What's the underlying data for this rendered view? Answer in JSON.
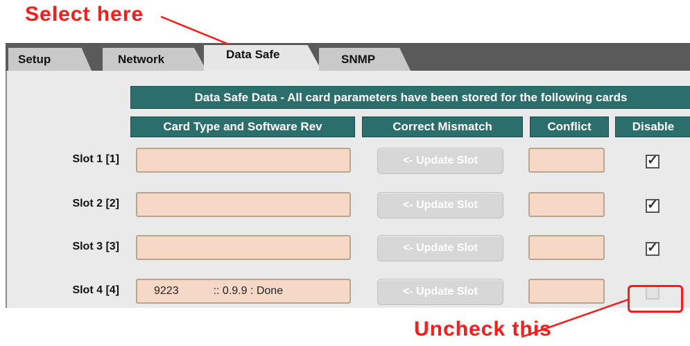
{
  "annotations": {
    "select_here": "Select here",
    "uncheck_this": "Uncheck this",
    "color": "#ff1a1a"
  },
  "tabs": [
    {
      "label": "Setup",
      "active": false
    },
    {
      "label": "Network",
      "active": false
    },
    {
      "label": "Data Safe",
      "active": true
    },
    {
      "label": "SNMP",
      "active": false
    }
  ],
  "headers": {
    "main": "Data Safe Data - All card parameters have been stored for the following cards",
    "card_type": "Card Type and Software Rev",
    "correct_mismatch": "Correct Mismatch",
    "conflict": "Conflict",
    "disable": "Disable"
  },
  "slots": [
    {
      "label": "Slot 1 [1]",
      "card_type": "",
      "version": "",
      "button": "<- Update Slot",
      "conflict": "",
      "disable": true
    },
    {
      "label": "Slot 2 [2]",
      "card_type": "",
      "version": "",
      "button": "<- Update Slot",
      "conflict": "",
      "disable": true
    },
    {
      "label": "Slot 3 [3]",
      "card_type": "",
      "version": "",
      "button": "<- Update Slot",
      "conflict": "",
      "disable": true
    },
    {
      "label": "Slot 4 [4]",
      "card_type": "9223",
      "version": ":: 0.9.9 : Done",
      "button": "<- Update Slot",
      "conflict": "",
      "disable": false
    }
  ],
  "colors": {
    "header_bg": "#2b6e6b",
    "field_bg": "#f6d8c7",
    "tabbar_bg": "#5a5a5a",
    "panel_bg": "#eaeaea"
  }
}
